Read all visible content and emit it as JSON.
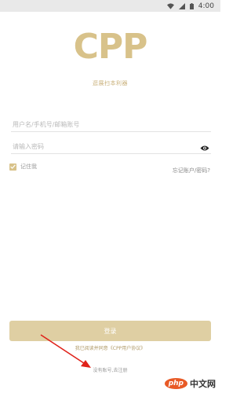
{
  "status_bar": {
    "time": "4:00"
  },
  "brand": {
    "logo_text": "CPP",
    "tagline": "逛展扫本利器"
  },
  "login_form": {
    "account_placeholder": "用户名/手机号/邮箱账号",
    "password_placeholder": "请输入密码",
    "remember_label": "记住我",
    "forgot_label": "忘记账户/密码?",
    "login_button": "登录",
    "agreement_text": "我已阅读并同意《CPP用户协议》",
    "register_text": "没有账号,去注册"
  },
  "watermark": {
    "php": "php",
    "site": "中文网"
  },
  "colors": {
    "accent": "#d8c28a",
    "button": "#dfcfa3",
    "arrow": "#e0221a"
  }
}
